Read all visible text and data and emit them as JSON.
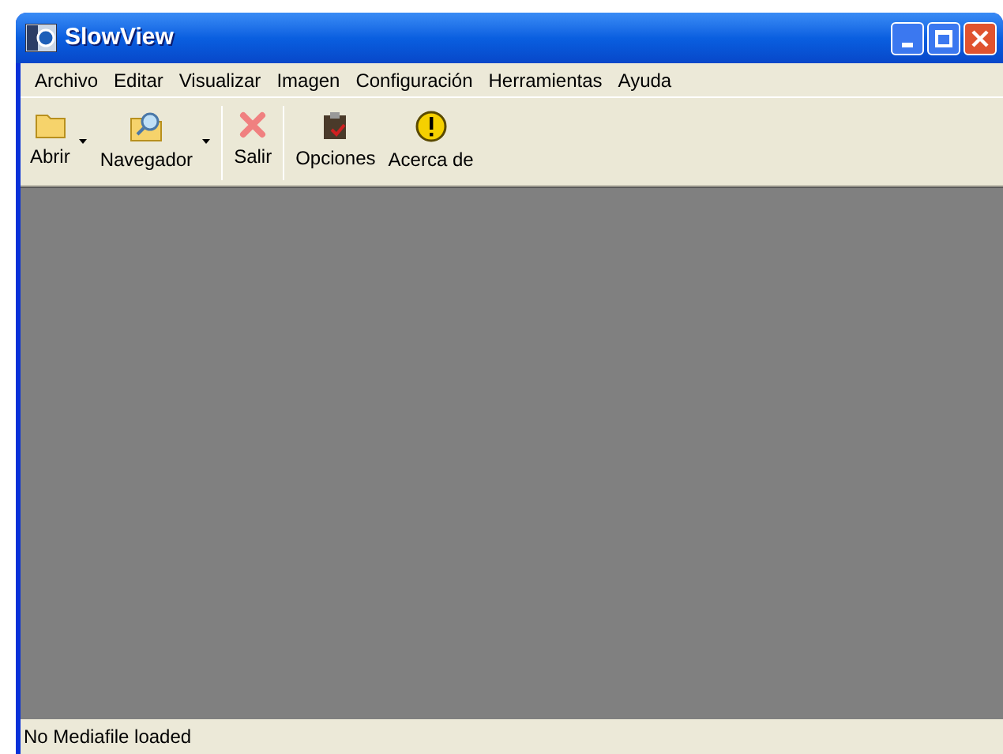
{
  "window": {
    "title": "SlowView"
  },
  "menu": [
    "Archivo",
    "Editar",
    "Visualizar",
    "Imagen",
    "Configuración",
    "Herramientas",
    "Ayuda"
  ],
  "toolbar": [
    {
      "kind": "folder",
      "label": "Abrir",
      "dropdown": true
    },
    {
      "kind": "browser",
      "label": "Navegador",
      "dropdown": true
    },
    {
      "kind": "separator"
    },
    {
      "kind": "exit",
      "label": "Salir",
      "dropdown": false
    },
    {
      "kind": "separator"
    },
    {
      "kind": "clipboard",
      "label": "Opciones",
      "dropdown": false
    },
    {
      "kind": "warning",
      "label": "Acerca de",
      "dropdown": false
    }
  ],
  "status_bar": "No Mediafile loaded"
}
